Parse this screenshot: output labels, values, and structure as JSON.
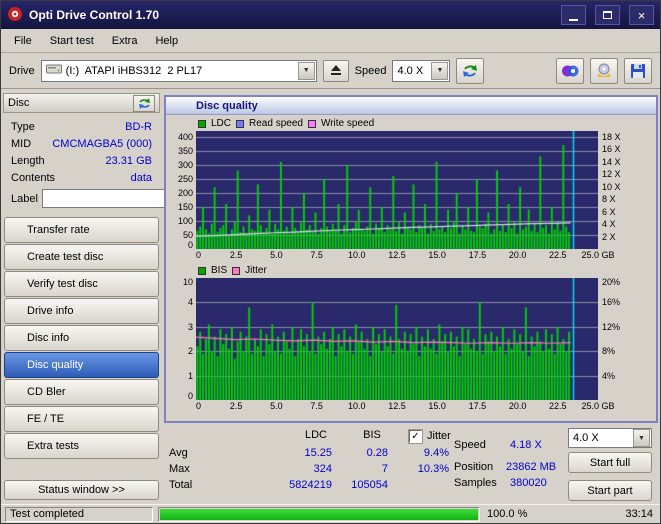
{
  "window": {
    "title": "Opti Drive Control 1.70"
  },
  "menu": {
    "items": [
      "File",
      "Start test",
      "Extra",
      "Help"
    ]
  },
  "toolbar": {
    "drive_label": "Drive",
    "drive_value": "(I:)  ATAPI iHBS312  2 PL17",
    "speed_label": "Speed",
    "speed_value": "4.0 X"
  },
  "sidebar": {
    "disc_header": "Disc",
    "info": [
      {
        "label": "Type",
        "value": "BD-R"
      },
      {
        "label": "MID",
        "value": "CMCMAGBA5 (000)"
      },
      {
        "label": "Length",
        "value": "23.31 GB"
      },
      {
        "label": "Contents",
        "value": "data"
      }
    ],
    "label_field": {
      "label": "Label",
      "value": ""
    },
    "buttons": [
      "Transfer rate",
      "Create test disc",
      "Verify test disc",
      "Drive info",
      "Disc info",
      "Disc quality",
      "CD Bler",
      "FE / TE",
      "Extra tests"
    ],
    "active_button": "Disc quality",
    "status_window": "Status window >>"
  },
  "panel": {
    "title": "Disc quality"
  },
  "chart_data": [
    {
      "type": "bar",
      "name": "ldc-read-speed-chart",
      "title": "Disc quality - LDC / Read speed",
      "bg": "#29296b",
      "grid_color": "#8d8da8",
      "bar_color": "#00d400",
      "marker_color": "#00e4ff",
      "legend": [
        {
          "label": "LDC",
          "color": "#00a800"
        },
        {
          "label": "Read speed",
          "color": "#7878ff"
        },
        {
          "label": "Write speed",
          "color": "#ff78ff"
        }
      ],
      "x_ticks": [
        "0",
        "2.5",
        "5.0",
        "7.5",
        "10.0",
        "12.5",
        "15.0",
        "17.5",
        "20.0",
        "22.5",
        "25.0 GB"
      ],
      "x_max_gb": 25,
      "data_end_gb": 23.3,
      "marker_x_gb": 23.45,
      "y_left_ticks": [
        400,
        350,
        300,
        250,
        200,
        150,
        100,
        50,
        0
      ],
      "y_left_max": 420,
      "x_units": 22.222,
      "y_right_ticks": [
        {
          "label": "18 X",
          "value": 18
        },
        {
          "label": "16 X",
          "value": 16
        },
        {
          "label": "14 X",
          "value": 14
        },
        {
          "label": "12 X",
          "value": 12
        },
        {
          "label": "10 X",
          "value": 10
        },
        {
          "label": "8 X",
          "value": 8
        },
        {
          "label": "6 X",
          "value": 6
        },
        {
          "label": "4 X",
          "value": 4
        },
        {
          "label": "2 X",
          "value": 2
        }
      ],
      "bars": [
        65,
        80,
        150,
        70,
        55,
        90,
        220,
        60,
        75,
        85,
        160,
        50,
        70,
        95,
        280,
        60,
        80,
        55,
        120,
        70,
        65,
        230,
        85,
        60,
        75,
        140,
        55,
        90,
        70,
        310,
        65,
        80,
        55,
        150,
        75,
        60,
        95,
        200,
        70,
        85,
        60,
        130,
        55,
        75,
        250,
        80,
        65,
        90,
        70,
        160,
        55,
        85,
        300,
        60,
        75,
        95,
        140,
        70,
        65,
        80,
        220,
        55,
        90,
        75,
        150,
        60,
        85,
        70,
        260,
        65,
        95,
        55,
        130,
        80,
        70,
        230,
        60,
        85,
        75,
        160,
        55,
        90,
        65,
        310,
        70,
        80,
        60,
        140,
        75,
        95,
        200,
        55,
        85,
        70,
        150,
        65,
        60,
        250,
        80,
        75,
        90,
        130,
        55,
        70,
        280,
        65,
        85,
        60,
        160,
        75,
        95,
        55,
        220,
        70,
        80,
        140,
        65,
        90,
        60,
        330,
        75,
        85,
        55,
        150,
        70,
        95,
        65,
        370,
        80,
        60
      ],
      "line": {
        "name": "Read speed",
        "unit": "X",
        "color": "#d8d8ee",
        "values": [
          2.05,
          2.15,
          2.3,
          2.45,
          2.6,
          2.7,
          2.85,
          3.0,
          3.1,
          3.2,
          3.35,
          3.45,
          3.55,
          3.65,
          3.75,
          3.85,
          3.95,
          4.05,
          4.12,
          4.18
        ]
      }
    },
    {
      "type": "bar",
      "name": "bis-jitter-chart",
      "title": "Disc quality - BIS / Jitter",
      "bg": "#29296b",
      "grid_color": "#8d8da8",
      "bar_color": "#00d400",
      "marker_color": "#00e4ff",
      "legend": [
        {
          "label": "BIS",
          "color": "#00a800"
        },
        {
          "label": "Jitter",
          "color": "#ff78c8"
        }
      ],
      "x_ticks": [
        "0",
        "2.5",
        "5.0",
        "7.5",
        "10.0",
        "12.5",
        "15.0",
        "17.5",
        "20.0",
        "22.5",
        "25.0 GB"
      ],
      "x_max_gb": 25,
      "data_end_gb": 23.3,
      "marker_x_gb": 23.45,
      "y_left_ticks": [
        10,
        4,
        3,
        2,
        1,
        0
      ],
      "jitter_max_pct": 20,
      "y_right_ticks": [
        {
          "label": "20%",
          "value": 20
        },
        {
          "label": "16%",
          "value": 16
        },
        {
          "label": "12%",
          "value": 12
        },
        {
          "label": "8%",
          "value": 8
        },
        {
          "label": "4%",
          "value": 4
        }
      ],
      "bars": [
        2.2,
        2.8,
        1.9,
        2.5,
        3.1,
        2.0,
        2.6,
        1.8,
        2.9,
        2.3,
        2.7,
        2.1,
        3.0,
        1.7,
        2.4,
        2.8,
        2.0,
        2.6,
        3.8,
        1.9,
        2.5,
        2.2,
        2.9,
        1.8,
        2.7,
        2.3,
        3.1,
        2.0,
        2.6,
        1.9,
        2.8,
        2.4,
        2.1,
        3.0,
        1.8,
        2.5,
        2.9,
        2.2,
        2.7,
        2.0,
        4.0,
        1.9,
        2.6,
        2.3,
        2.8,
        2.1,
        2.5,
        3.0,
        1.8,
        2.7,
        2.2,
        2.9,
        2.0,
        2.6,
        1.9,
        3.1,
        2.4,
        2.8,
        2.1,
        2.5,
        1.8,
        3.0,
        2.3,
        2.7,
        2.0,
        2.9,
        2.2,
        2.6,
        1.9,
        3.9,
        2.5,
        2.1,
        2.8,
        2.0,
        2.7,
        2.3,
        3.0,
        1.8,
        2.6,
        2.2,
        2.9,
        2.1,
        2.5,
        1.9,
        3.1,
        2.4,
        2.7,
        2.0,
        2.8,
        2.2,
        2.6,
        1.8,
        3.0,
        2.3,
        2.9,
        2.1,
        2.5,
        2.0,
        4.1,
        1.9,
        2.7,
        2.4,
        2.8,
        2.0,
        2.6,
        2.2,
        3.0,
        1.9,
        2.5,
        2.1,
        2.9,
        2.3,
        2.7,
        2.0,
        3.8,
        1.8,
        2.6,
        2.2,
        2.8,
        2.4,
        2.0,
        2.9,
        2.1,
        2.7,
        1.9,
        3.0,
        2.3,
        2.5,
        2.0,
        2.8
      ],
      "line": {
        "name": "Jitter",
        "unit": "%",
        "color": "#ff78c8",
        "values": [
          10.3,
          10.1,
          9.9,
          10.0,
          9.8,
          9.7,
          9.8,
          9.6,
          9.7,
          9.5,
          9.6,
          9.4,
          9.5,
          9.4,
          9.3,
          9.4,
          9.3,
          9.4,
          9.3,
          9.4
        ]
      }
    }
  ],
  "stats": {
    "col_ldc": "LDC",
    "col_bis": "BIS",
    "jitter_label": "Jitter",
    "jitter_checked": true,
    "rows": [
      {
        "label": "Avg",
        "ldc": "15.25",
        "bis": "0.28",
        "jitter": "9.4%"
      },
      {
        "label": "Max",
        "ldc": "324",
        "bis": "7",
        "jitter": "10.3%"
      },
      {
        "label": "Total",
        "ldc": "5824219",
        "bis": "105054",
        "jitter": ""
      }
    ],
    "speed_label": "Speed",
    "speed_value": "4.18 X",
    "position_label": "Position",
    "position_value": "23862 MB",
    "samples_label": "Samples",
    "samples_value": "380020",
    "write_speed": "4.0 X",
    "start_full": "Start full",
    "start_part": "Start part"
  },
  "statusbar": {
    "status": "Test completed",
    "progress": "100.0 %",
    "progress_pct": 100,
    "time": "33:14"
  },
  "colors": {
    "titlebar": "#1b1b52",
    "active_button": "#2d5cb8",
    "value_text": "#0000cc",
    "progress_green": "#1ecb1e",
    "panel_border": "#8080c2"
  },
  "icons": {
    "dropdown_arrow": "▼",
    "check": "✓",
    "close": "×"
  }
}
